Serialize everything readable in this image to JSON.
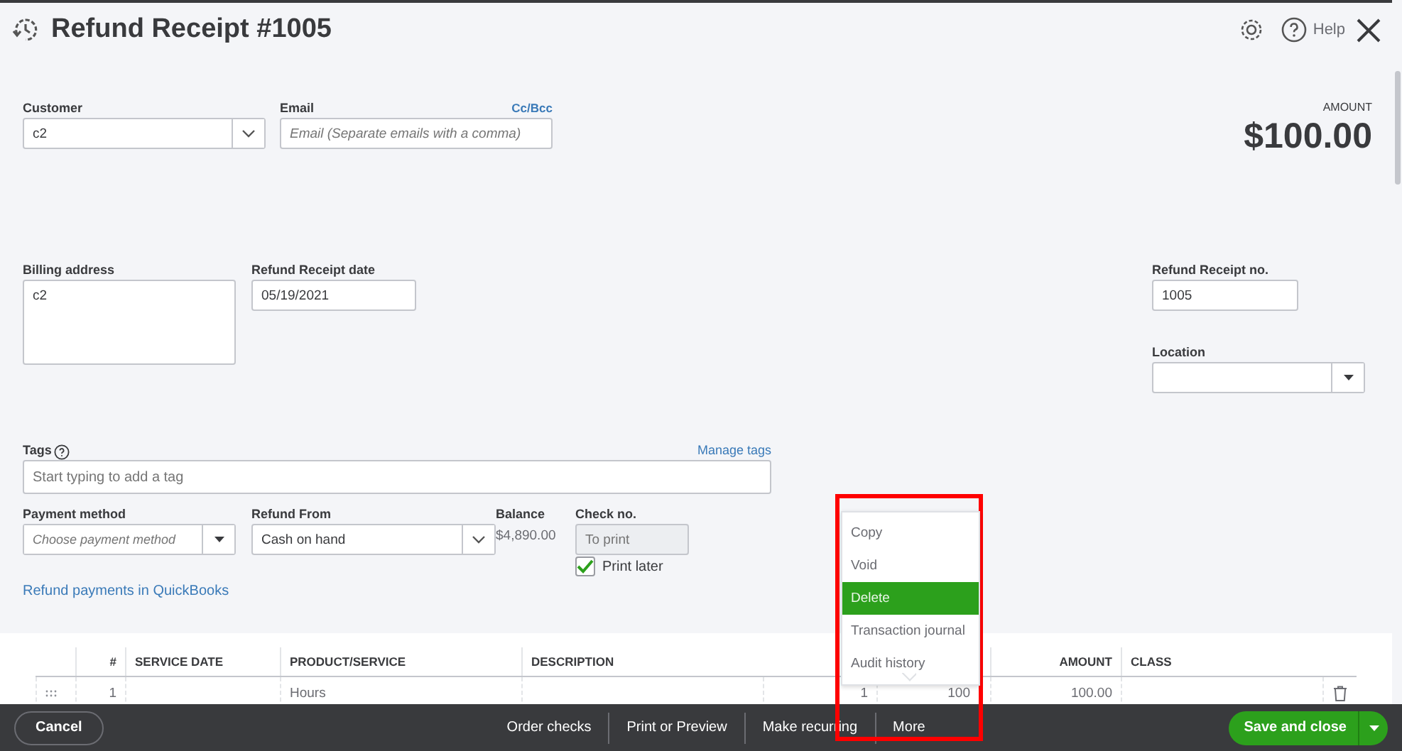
{
  "header": {
    "title": "Refund Receipt #1005",
    "help": "Help"
  },
  "customer": {
    "label": "Customer",
    "value": "c2"
  },
  "email": {
    "label": "Email",
    "placeholder": "Email (Separate emails with a comma)",
    "link": "Cc/Bcc"
  },
  "amount": {
    "label": "AMOUNT",
    "value": "$100.00"
  },
  "billing_address": {
    "label": "Billing address",
    "value": "c2"
  },
  "receipt_date": {
    "label": "Refund Receipt date",
    "value": "05/19/2021"
  },
  "receipt_no": {
    "label": "Refund Receipt no.",
    "value": "1005"
  },
  "location": {
    "label": "Location"
  },
  "tags": {
    "label": "Tags",
    "placeholder": "Start typing to add a tag",
    "link": "Manage tags"
  },
  "payment_method": {
    "label": "Payment method",
    "placeholder": "Choose payment method"
  },
  "refund_from": {
    "label": "Refund From",
    "value": "Cash on hand"
  },
  "balance": {
    "label": "Balance",
    "value": "$4,890.00"
  },
  "check_no": {
    "label": "Check no.",
    "placeholder": "To print",
    "disabled": true
  },
  "print_later": {
    "label": "Print later",
    "checked": true
  },
  "refund_link": "Refund payments in QuickBooks",
  "table": {
    "columns": [
      "#",
      "SERVICE DATE",
      "PRODUCT/SERVICE",
      "DESCRIPTION",
      "AMOUNT",
      "CLASS"
    ],
    "rows": [
      {
        "number": "1",
        "product": "Hours",
        "qty": "1",
        "rate": "100",
        "amount": "100.00"
      }
    ]
  },
  "more_menu": {
    "items": [
      {
        "label": "Copy",
        "selected": false
      },
      {
        "label": "Void",
        "selected": false
      },
      {
        "label": "Delete",
        "selected": true
      },
      {
        "label": "Transaction journal",
        "selected": false
      },
      {
        "label": "Audit history",
        "selected": false
      }
    ]
  },
  "footer": {
    "cancel": "Cancel",
    "actions": [
      "Order checks",
      "Print or Preview",
      "Make recurring",
      "More"
    ],
    "save": "Save and close"
  }
}
